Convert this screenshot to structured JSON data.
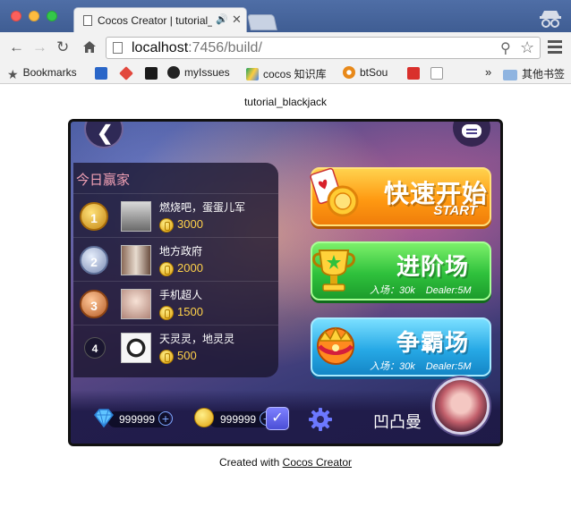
{
  "browser": {
    "tab_title": "Cocos Creator | tutorial_blackjack",
    "url_host": "localhost",
    "url_rest": ":7456/build/"
  },
  "bookmarks": {
    "items": [
      "Bookmarks",
      "myIssues",
      "cocos 知识库",
      "btSou"
    ],
    "overflow": "»",
    "other": "其他书签"
  },
  "page": {
    "title": "tutorial_blackjack",
    "footer_prefix": "Created with ",
    "footer_link": "Cocos Creator"
  },
  "game": {
    "leaderboard": {
      "title": "今日赢家",
      "players": [
        {
          "rank": "1",
          "medal": "gold",
          "name": "燃烧吧，蛋蛋儿军",
          "coins": "3000"
        },
        {
          "rank": "2",
          "medal": "silver",
          "name": "地方政府",
          "coins": "2000"
        },
        {
          "rank": "3",
          "medal": "bronze",
          "name": "手机超人",
          "coins": "1500"
        },
        {
          "rank": "4",
          "medal": "plain",
          "name": "天灵灵，地灵灵",
          "coins": "500"
        }
      ]
    },
    "modes": {
      "quick": {
        "title": "快速开始",
        "subtitle": "START"
      },
      "advanced": {
        "title": "进阶场",
        "entry": "入场：30k",
        "dealer": "Dealer:5M"
      },
      "champion": {
        "title": "争霸场",
        "entry": "入场：30k",
        "dealer": "Dealer:5M"
      }
    },
    "user": {
      "diamonds": "999999",
      "gold": "999999",
      "name": "凹凸曼"
    }
  },
  "colors": {
    "quick_button": "#ff9a12",
    "advanced_button": "#2fc13c",
    "champion_button": "#27a9e6",
    "coin_text": "#ffd24a"
  }
}
